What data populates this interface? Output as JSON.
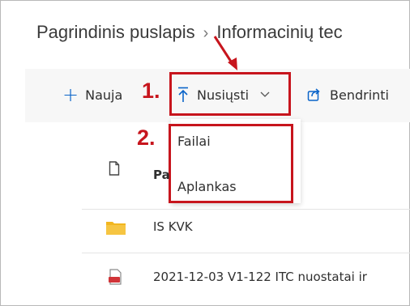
{
  "breadcrumb": {
    "home": "Pagrindinis puslapis",
    "separator": "›",
    "current": "Informacinių tec"
  },
  "commandbar": {
    "new_label": "Nauja",
    "upload_label": "Nusiųsti",
    "share_label": "Bendrinti"
  },
  "upload_menu": {
    "items": [
      "Failai",
      "Aplankas"
    ]
  },
  "annotations": {
    "step1": "1.",
    "step2": "2."
  },
  "file_list": {
    "header_name_partial": "Pa",
    "rows": [
      {
        "icon": "folder-icon",
        "name": "IS KVK"
      },
      {
        "icon": "pdf-file-icon",
        "name": "2021-12-03 V1-122 ITC nuostatai ir"
      }
    ]
  },
  "colors": {
    "accent": "#0a64c9",
    "annotation_red": "#c7151d",
    "folder_yellow": "#f2b620",
    "pdf_red": "#d13438"
  }
}
